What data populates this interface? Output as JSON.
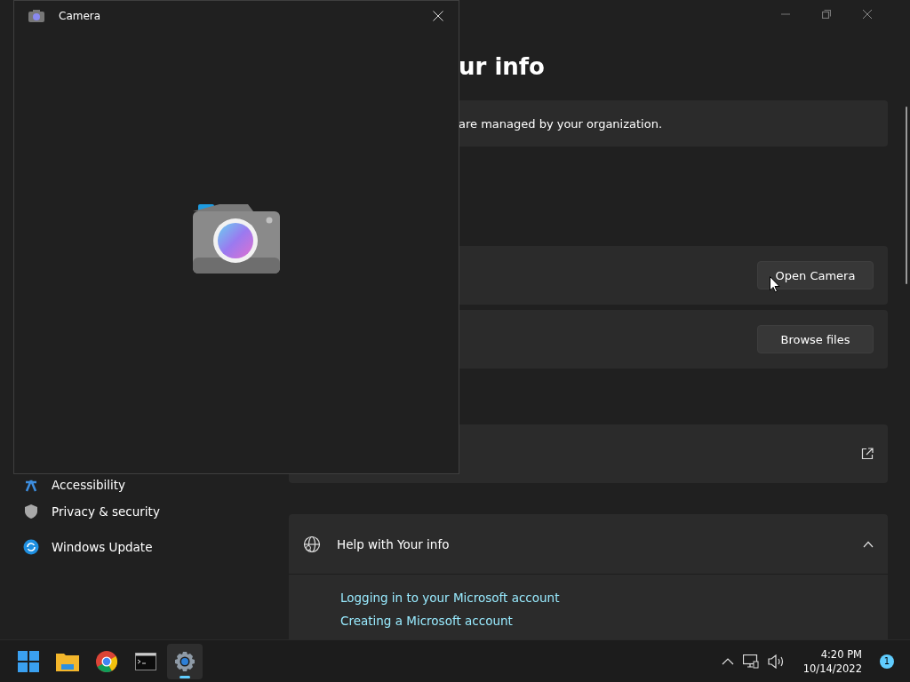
{
  "settings": {
    "title": "ur info",
    "notice": "are managed by your organization.",
    "sidebar": {
      "items": [
        {
          "label": "Accessibility",
          "kind": "accessibility"
        },
        {
          "label": "Privacy & security",
          "kind": "privacy"
        },
        {
          "label": "Windows Update",
          "kind": "update"
        }
      ]
    },
    "cards": [
      {
        "kind": "button",
        "button": "Open Camera"
      },
      {
        "kind": "button",
        "button": "Browse files"
      },
      {
        "kind": "link"
      }
    ],
    "help": {
      "title": "Help with Your info",
      "expanded": true,
      "links": [
        "Logging in to your Microsoft account",
        "Creating a Microsoft account"
      ]
    }
  },
  "camera_window": {
    "title": "Camera"
  },
  "taskbar": {
    "apps": [
      {
        "kind": "start",
        "selected": false
      },
      {
        "kind": "folder",
        "selected": false
      },
      {
        "kind": "browser",
        "selected": false
      },
      {
        "kind": "terminal",
        "selected": false
      },
      {
        "kind": "settings",
        "selected": true
      }
    ],
    "time": "4:20 PM",
    "date": "10/14/2022",
    "notifications": "1"
  }
}
